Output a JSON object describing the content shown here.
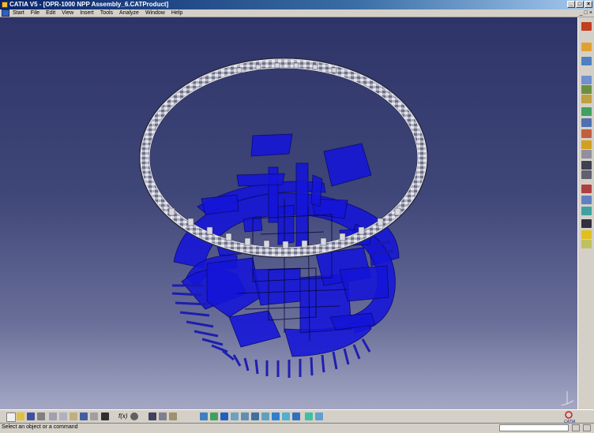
{
  "window": {
    "title": "CATIA V5 - [OPR-1000 NPP Assembly_6.CATProduct]",
    "controls": [
      "_",
      "□",
      "×"
    ]
  },
  "menubar": {
    "items": [
      "Start",
      "File",
      "Edit",
      "View",
      "Insert",
      "Tools",
      "Analyze",
      "Window",
      "Help"
    ],
    "doc_controls": [
      "_",
      "□",
      "×"
    ]
  },
  "viewport": {
    "background_top": "#2e3468",
    "background_bottom": "#a4a8c4",
    "model_color": "#1a1ad8",
    "ring_color": "#c8c8d0"
  },
  "right_toolbar": {
    "icons": [
      "select-icon",
      "fly-mode-icon",
      "product-icon",
      "insert-component-icon",
      "existing-component-icon",
      "replace-icon",
      "graph-tree-icon",
      "generate-numbering-icon",
      "move-icon",
      "snap-icon",
      "explode-icon",
      "constraint-icon",
      "fix-icon",
      "coincidence-icon",
      "contact-icon",
      "offset-icon",
      "angle-icon",
      "update-icon",
      "scene-icon",
      "clash-icon",
      "sectioning-icon",
      "distance-icon",
      "light-icon",
      "annotation-icon"
    ]
  },
  "bottom_toolbar": {
    "fog_label": "f(x)",
    "icons": [
      "new-icon",
      "open-icon",
      "save-icon",
      "print-icon",
      "cut-icon",
      "copy-icon",
      "paste-icon",
      "undo-icon",
      "redo-icon",
      "whats-this-icon",
      "formula-icon",
      "comment-icon",
      "catalog-icon",
      "knowledge-icon",
      "fly-icon",
      "fit-all-icon",
      "pan-icon",
      "rotate-icon",
      "zoom-in-icon",
      "zoom-out-icon",
      "normal-view-icon",
      "iso-view-icon",
      "shading-icon",
      "hide-show-icon",
      "swap-space-icon",
      "measure-icon"
    ]
  },
  "statusbar": {
    "message": "Select an object or a command"
  },
  "logo": {
    "text": "CATIA"
  }
}
